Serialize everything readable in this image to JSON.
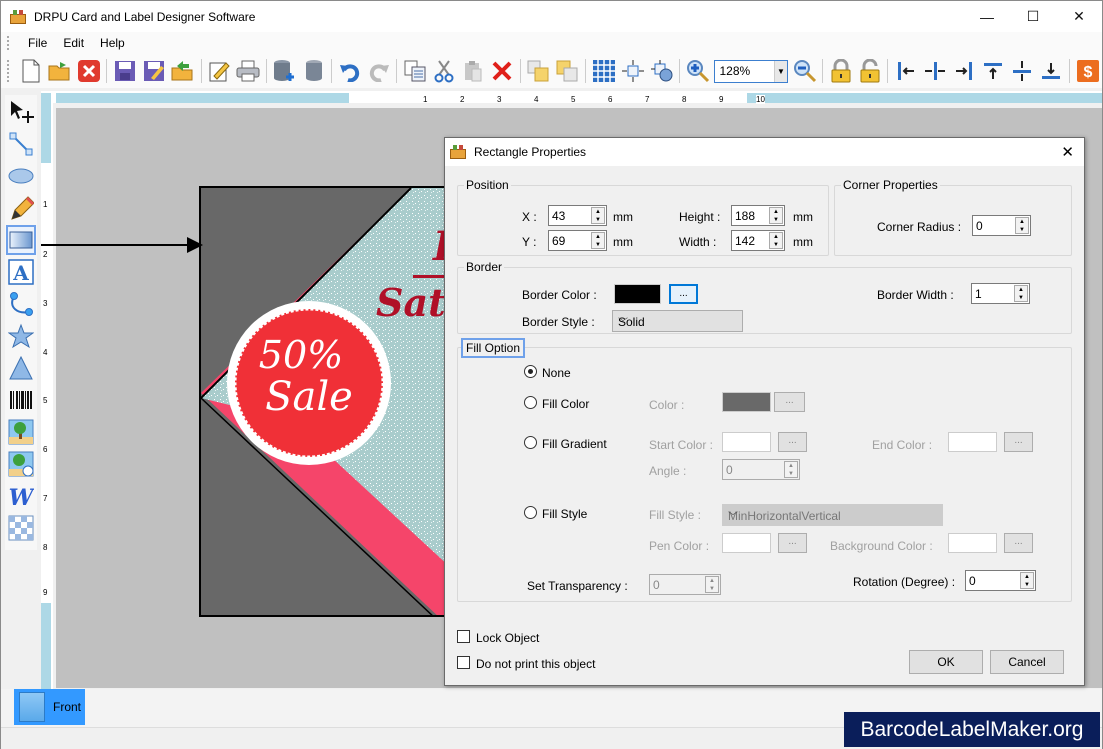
{
  "window": {
    "title": "DRPU Card and Label Designer Software",
    "controls": {
      "minimize": "—",
      "maximize": "☐",
      "close": "✕"
    }
  },
  "menu": [
    "File",
    "Edit",
    "Help"
  ],
  "toolbar": {
    "icons": [
      "new-icon",
      "open-icon",
      "close-file-icon",
      "save-icon",
      "save-as-icon",
      "export-icon",
      "edit-icon",
      "print-icon",
      "database-add-icon",
      "database-icon",
      "undo-icon",
      "redo-icon",
      "copy-icon",
      "cut-icon",
      "paste-icon",
      "delete-icon",
      "bring-front-icon",
      "send-back-icon",
      "grid-icon",
      "center-icon",
      "rotate-settings-icon",
      "zoom-in-icon",
      "zoom-out-icon",
      "lock-icon",
      "unlock-icon",
      "align-left-icon",
      "align-center-icon",
      "align-right-icon",
      "align-top-icon",
      "align-middle-icon",
      "align-bottom-icon",
      "price-icon"
    ],
    "zoom_value": "128%"
  },
  "left_tools": [
    "pointer-tool",
    "line-tool",
    "ellipse-tool",
    "pencil-tool",
    "rectangle-tool",
    "text-tool",
    "curve-tool",
    "star-tool",
    "triangle-tool",
    "barcode-tool",
    "image-tool",
    "image-library-tool",
    "wordart-tool",
    "watermark-tool"
  ],
  "ruler": {
    "h_ticks": [
      "1",
      "2",
      "3",
      "4",
      "5",
      "6",
      "7",
      "8",
      "9",
      "10"
    ],
    "v_ticks": [
      "1",
      "2",
      "3",
      "4",
      "5",
      "6",
      "7",
      "8",
      "9"
    ]
  },
  "card": {
    "badge_line1": "50%",
    "badge_line2": "Sale",
    "headline_partial": "Sat"
  },
  "dialog": {
    "title": "Rectangle Properties",
    "position": {
      "legend": "Position",
      "x_label": "X :",
      "x_value": "43",
      "y_label": "Y :",
      "y_value": "69",
      "height_label": "Height :",
      "height_value": "188",
      "width_label": "Width :",
      "width_value": "142",
      "unit": "mm"
    },
    "corner": {
      "legend": "Corner Properties",
      "radius_label": "Corner Radius :",
      "radius_value": "0"
    },
    "border": {
      "legend": "Border",
      "color_label": "Border Color :",
      "color": "#000000",
      "dots": "...",
      "style_label": "Border Style :",
      "style_value": "Solid",
      "width_label": "Border Width :",
      "width_value": "1"
    },
    "fill": {
      "legend": "Fill Option",
      "none": "None",
      "fill_color": "Fill Color",
      "color_label": "Color :",
      "color_value": "#696969",
      "fill_gradient": "Fill Gradient",
      "start_color_label": "Start Color :",
      "end_color_label": "End Color :",
      "angle_label": "Angle :",
      "angle_value": "0",
      "fill_style": "Fill Style",
      "fill_style_label": "Fill Style :",
      "fill_style_value": "MinHorizontalVertical",
      "pen_color_label": "Pen Color :",
      "bg_color_label": "Background Color :",
      "transparency_label": "Set Transparency :",
      "transparency_value": "0",
      "rotation_label": "Rotation (Degree) :",
      "rotation_value": "0",
      "selected": "None"
    },
    "lock_object": "Lock Object",
    "no_print": "Do not print this object",
    "ok": "OK",
    "cancel": "Cancel"
  },
  "bottom": {
    "tab_front": "Front"
  },
  "watermark": "BarcodeLabelMaker.org"
}
